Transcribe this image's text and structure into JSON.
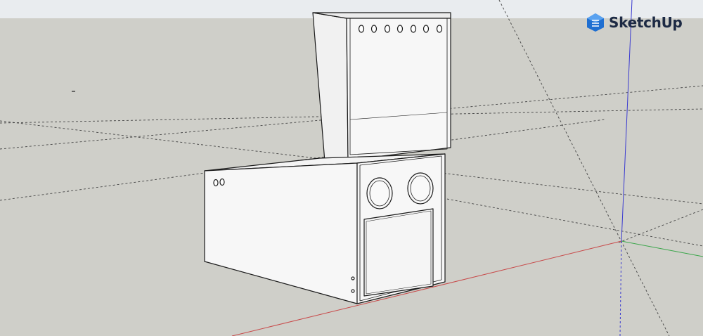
{
  "app": {
    "name": "SketchUp",
    "logo_icon": "sketchup-logo-icon",
    "logo_color": "#1f6fd1"
  },
  "viewport": {
    "sky_color": "#e9ecef",
    "ground_color": "#cfcfc9",
    "model_fill": "#f7f7f7",
    "edge_color": "#1a1a1a",
    "axis_red": "#c84a4a",
    "axis_green": "#3aa64a",
    "axis_blue": "#3a3ad0",
    "guide_color": "#444444"
  }
}
